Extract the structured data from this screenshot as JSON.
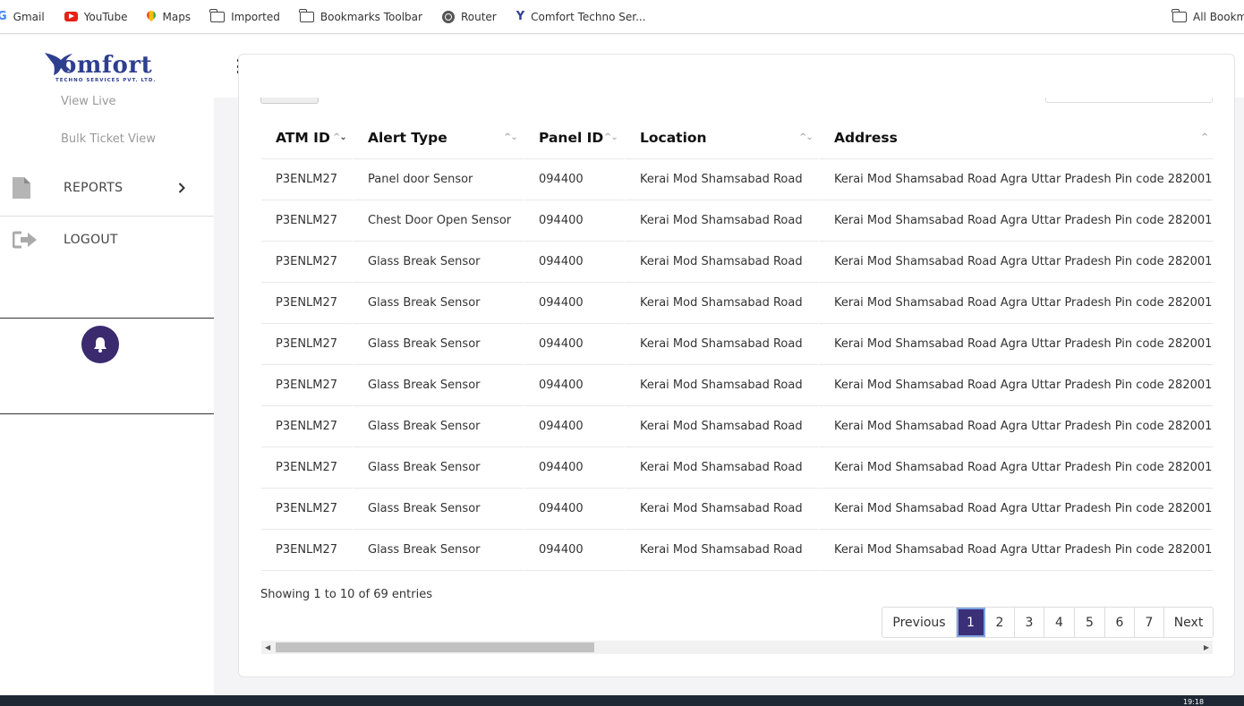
{
  "bookmarks": [
    {
      "label": "Gmail",
      "icon": "google-icon"
    },
    {
      "label": "YouTube",
      "icon": "youtube-icon"
    },
    {
      "label": "Maps",
      "icon": "maps-icon"
    },
    {
      "label": "Imported",
      "icon": "folder-icon"
    },
    {
      "label": "Bookmarks Toolbar",
      "icon": "folder-icon"
    },
    {
      "label": "Router",
      "icon": "globe-icon"
    },
    {
      "label": "Comfort Techno Ser...",
      "icon": "comfort-icon"
    }
  ],
  "bookmarks_right": {
    "label": "All Bookma",
    "icon": "folder-icon"
  },
  "logo": {
    "word": "omfort",
    "sub": "TECHNO SERVICES PVT. LTD."
  },
  "sidebar": {
    "sub_items": [
      "View Live",
      "Bulk Ticket View"
    ],
    "reports_label": "REPORTS",
    "logout_label": "LOGOUT"
  },
  "table": {
    "headers": [
      "ATM ID",
      "Alert Type",
      "Panel ID",
      "Location",
      "Address"
    ],
    "rows": [
      [
        "P3ENLM27",
        "Panel door Sensor",
        "094400",
        "Kerai Mod Shamsabad Road",
        "Kerai Mod Shamsabad Road Agra Uttar Pradesh Pin code 282001"
      ],
      [
        "P3ENLM27",
        "Chest Door Open Sensor",
        "094400",
        "Kerai Mod Shamsabad Road",
        "Kerai Mod Shamsabad Road Agra Uttar Pradesh Pin code 282001"
      ],
      [
        "P3ENLM27",
        "Glass Break Sensor",
        "094400",
        "Kerai Mod Shamsabad Road",
        "Kerai Mod Shamsabad Road Agra Uttar Pradesh Pin code 282001"
      ],
      [
        "P3ENLM27",
        "Glass Break Sensor",
        "094400",
        "Kerai Mod Shamsabad Road",
        "Kerai Mod Shamsabad Road Agra Uttar Pradesh Pin code 282001"
      ],
      [
        "P3ENLM27",
        "Glass Break Sensor",
        "094400",
        "Kerai Mod Shamsabad Road",
        "Kerai Mod Shamsabad Road Agra Uttar Pradesh Pin code 282001"
      ],
      [
        "P3ENLM27",
        "Glass Break Sensor",
        "094400",
        "Kerai Mod Shamsabad Road",
        "Kerai Mod Shamsabad Road Agra Uttar Pradesh Pin code 282001"
      ],
      [
        "P3ENLM27",
        "Glass Break Sensor",
        "094400",
        "Kerai Mod Shamsabad Road",
        "Kerai Mod Shamsabad Road Agra Uttar Pradesh Pin code 282001"
      ],
      [
        "P3ENLM27",
        "Glass Break Sensor",
        "094400",
        "Kerai Mod Shamsabad Road",
        "Kerai Mod Shamsabad Road Agra Uttar Pradesh Pin code 282001"
      ],
      [
        "P3ENLM27",
        "Glass Break Sensor",
        "094400",
        "Kerai Mod Shamsabad Road",
        "Kerai Mod Shamsabad Road Agra Uttar Pradesh Pin code 282001"
      ],
      [
        "P3ENLM27",
        "Glass Break Sensor",
        "094400",
        "Kerai Mod Shamsabad Road",
        "Kerai Mod Shamsabad Road Agra Uttar Pradesh Pin code 282001"
      ]
    ]
  },
  "info": "Showing 1 to 10 of 69 entries",
  "pagination": {
    "previous": "Previous",
    "pages": [
      "1",
      "2",
      "3",
      "4",
      "5",
      "6",
      "7"
    ],
    "active": "1",
    "next": "Next"
  },
  "taskbar": {
    "clock": "19:18"
  },
  "colors": {
    "accent": "#3b2f78",
    "brand": "#2f3f8f"
  }
}
